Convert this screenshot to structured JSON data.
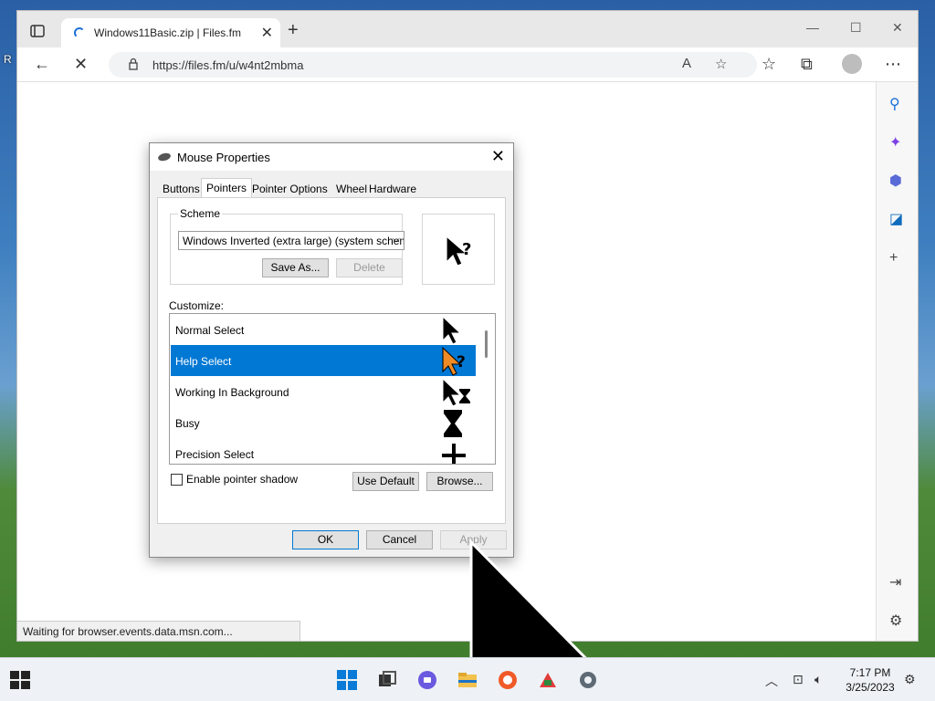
{
  "browser": {
    "tab_title": "Windows11Basic.zip | Files.fm",
    "tab_close": "✕",
    "new_tab": "+",
    "url": "https://files.fm/u/w4nt2mbma",
    "status": "Waiting for browser.events.data.msn.com..."
  },
  "dialog": {
    "title": "Mouse Properties",
    "close": "✕",
    "tabs": [
      "Buttons",
      "Pointers",
      "Pointer Options",
      "Wheel",
      "Hardware"
    ],
    "active_tab": "Pointers",
    "scheme": {
      "label": "Scheme",
      "selected": "Windows Inverted (extra large) (system scheme)",
      "save_as": "Save As...",
      "delete": "Delete"
    },
    "customize_label": "Customize:",
    "pointers": [
      {
        "label": "Normal Select",
        "icon": "arrow-cursor-icon"
      },
      {
        "label": "Help Select",
        "icon": "help-cursor-icon",
        "selected": true
      },
      {
        "label": "Working In Background",
        "icon": "working-cursor-icon"
      },
      {
        "label": "Busy",
        "icon": "hourglass-cursor-icon"
      },
      {
        "label": "Precision Select",
        "icon": "crosshair-cursor-icon"
      }
    ],
    "enable_shadow": "Enable pointer shadow",
    "use_default": "Use Default",
    "browse": "Browse...",
    "ok": "OK",
    "cancel": "Cancel",
    "apply": "Apply"
  },
  "taskbar": {
    "time": "7:17 PM",
    "date": "3/25/2023"
  },
  "colors": {
    "selection": "#0078d4",
    "help_cursor_selected": "#f08a24"
  }
}
